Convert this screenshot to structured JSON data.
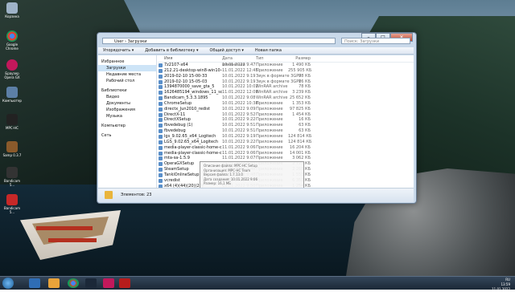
{
  "desktop": {
    "icons": [
      {
        "label": "Корзина",
        "icon": "recycle-bin-icon"
      },
      {
        "label": "Google Chrome",
        "icon": "chrome-icon"
      },
      {
        "label": "Браузер Opera GX",
        "icon": "opera-gx-icon"
      },
      {
        "label": "Компьютер",
        "icon": "computer-icon"
      },
      {
        "label": "MPC-HC",
        "icon": "mpc-hc-icon"
      },
      {
        "label": "Samp 0.3.7",
        "icon": "samp-icon"
      },
      {
        "label": "Bandicam 5...",
        "icon": "bandicam-icon"
      },
      {
        "label": "Bandicam 5...",
        "icon": "bandicam-icon"
      }
    ]
  },
  "window": {
    "title_buttons": [
      "–",
      "□",
      "✕"
    ],
    "address": "User › Загрузки",
    "search_placeholder": "Поиск: Загрузки",
    "toolbar": [
      "Упорядочить ▾",
      "Добавить в библиотеку ▾",
      "Общий доступ ▾",
      "Новая папка"
    ],
    "sidebar": {
      "favorites_header": "Избранное",
      "favorites": [
        "Загрузки",
        "Недавние места",
        "Рабочий стол"
      ],
      "libraries_header": "Библиотеки",
      "libraries": [
        "Видео",
        "Документы",
        "Изображения",
        "Музыка"
      ],
      "computer": "Компьютер",
      "network": "Сеть"
    },
    "columns": [
      "Имя",
      "Дата изменения",
      "Тип",
      "Размер"
    ],
    "files": [
      {
        "name": "7z2107-x64",
        "date": "10.01.2022 9:47",
        "type": "Приложение",
        "size": "1 490 КБ"
      },
      {
        "name": "212.21-desktop-win8-win10-64bit...",
        "date": "11.01.2022 12:45",
        "type": "Приложение",
        "size": "255 905 КБ"
      },
      {
        "name": "2019-02-10 15-00-33",
        "date": "10.01.2022 9:19",
        "type": "Звук в формате 3GPP",
        "size": "98 КБ"
      },
      {
        "name": "2019-02-10 15-05-03",
        "date": "10.01.2022 9:19",
        "type": "Звук в формате 3GPP",
        "size": "16 КБ"
      },
      {
        "name": "1394870000_save_gta_5",
        "date": "10.01.2022 10:02",
        "type": "WinRAR archive",
        "size": "78 КБ"
      },
      {
        "name": "1626485194_windows_11_soundpack_by...",
        "date": "11.01.2022 12:08",
        "type": "WinRAR archive",
        "size": "3 239 КБ"
      },
      {
        "name": "Bandicam_5.3.3.1895",
        "date": "10.01.2022 9:08",
        "type": "WinRAR archive",
        "size": "25 652 КБ"
      },
      {
        "name": "ChromeSetup",
        "date": "10.01.2022 10:38",
        "type": "Приложение",
        "size": "1 353 КБ"
      },
      {
        "name": "directx_Jun2010_redist",
        "date": "10.01.2022 9:09",
        "type": "Приложение",
        "size": "97 825 КБ"
      },
      {
        "name": "DirectX-11",
        "date": "10.01.2022 9:52",
        "type": "Приложение",
        "size": "1 454 КБ"
      },
      {
        "name": "DirectXSetup",
        "date": "10.01.2022 9:22",
        "type": "Приложение",
        "size": "16 КБ"
      },
      {
        "name": "fbvedebug (1)",
        "date": "10.01.2022 9:51",
        "type": "Приложение",
        "size": "63 КБ"
      },
      {
        "name": "fbvedebug",
        "date": "10.01.2022 9:51",
        "type": "Приложение",
        "size": "63 КБ"
      },
      {
        "name": "lgs_9.02.65_x64_Logitech",
        "date": "10.01.2022 9:19",
        "type": "Приложение",
        "size": "124 814 КБ"
      },
      {
        "name": "LGS_9.02.65_x64_Logitech",
        "date": "10.01.2022 9:22",
        "type": "Приложение",
        "size": "124 814 КБ"
      },
      {
        "name": "media-player-classic-home-cinema-1-7...",
        "date": "11.01.2022 9:06",
        "type": "Приложение",
        "size": "16 204 КБ"
      },
      {
        "name": "media-player-classic-home-cinema-1-7...",
        "date": "11.01.2022 9:06",
        "type": "Приложение",
        "size": "14 001 КБ"
      },
      {
        "name": "mta-sa-1.5.9",
        "date": "11.01.2022 9:07",
        "type": "Приложение",
        "size": "3 062 КБ"
      },
      {
        "name": "OperaGXSetup",
        "date": "10.01.2022 9:48",
        "type": "Приложение",
        "size": "2 729 КБ"
      },
      {
        "name": "SteamSetup",
        "date": "10.01.2022 9:48",
        "type": "Приложение",
        "size": "2 265 КБ"
      },
      {
        "name": "TankiOnlineSetup",
        "date": "10.01.2022 9:48",
        "type": "Приложение",
        "size": "1 553 КБ"
      },
      {
        "name": "vcredist",
        "date": "10.01.2022 9:49",
        "type": "Приложение",
        "size": "6 352 КБ"
      },
      {
        "name": "x64 (4)(44)(20)(20)",
        "date": "10.01.2022 9:50",
        "type": "Приложение",
        "size": "1 254 КБ"
      }
    ],
    "tooltip": [
      "Описание файла: MPC-HC Setup",
      "Организация: MPC-HC Team",
      "Версия файла: 1.7.13.0",
      "Дата создания: 10.01.2022 9:06",
      "Размер: 16,1 МБ"
    ],
    "status": "Элементов: 23"
  },
  "taskbar": {
    "lang": "RU",
    "time": "13:59",
    "date": "11.01.2022"
  }
}
